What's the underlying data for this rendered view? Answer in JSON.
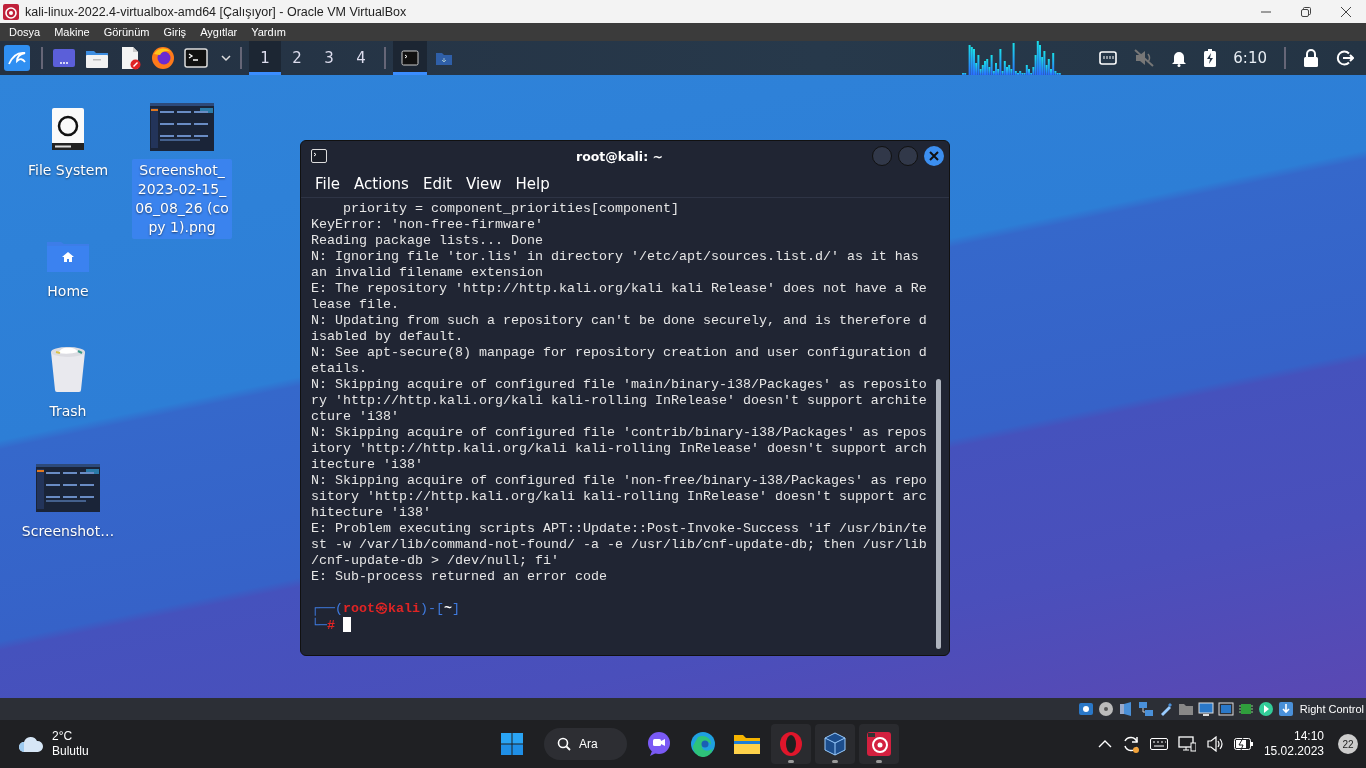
{
  "host_window": {
    "title": "kali-linux-2022.4-virtualbox-amd64 [Çalışıyor] - Oracle VM VirtualBox"
  },
  "vbox_menu": [
    "Dosya",
    "Makine",
    "Görünüm",
    "Giriş",
    "Aygıtlar",
    "Yardım"
  ],
  "kali_panel": {
    "launchers": [
      {
        "kind": "window"
      },
      {
        "kind": "files"
      },
      {
        "kind": "editor"
      },
      {
        "kind": "browser"
      },
      {
        "kind": "terminal"
      }
    ],
    "workspaces": [
      {
        "label": "1",
        "selected": true
      },
      {
        "label": "2",
        "selected": false
      },
      {
        "label": "3",
        "selected": false
      },
      {
        "label": "4",
        "selected": false
      }
    ],
    "tasks": [
      {
        "kind": "terminal",
        "selected": true
      },
      {
        "kind": "folder",
        "selected": false
      }
    ],
    "muted": true,
    "clock": "6:10"
  },
  "desktop_icons": [
    {
      "kind": "drive",
      "label": "File System",
      "selected": false
    },
    {
      "kind": "image",
      "label": "Screenshot_2023-02-15_06_08_26 (copy 1).png",
      "selected": true
    },
    {
      "kind": "home",
      "label": "Home",
      "selected": false
    },
    {
      "kind": "trash",
      "label": "Trash",
      "selected": false
    },
    {
      "kind": "image",
      "label": "Screenshot…",
      "selected": false
    }
  ],
  "terminal": {
    "title": "root@kali: ~",
    "menu": [
      "File",
      "Actions",
      "Edit",
      "View",
      "Help"
    ],
    "lines": [
      "    priority = component_priorities[component]",
      "KeyError: 'non-free-firmware'",
      "Reading package lists... Done",
      "N: Ignoring file 'tor.lis' in directory '/etc/apt/sources.list.d/' as it has",
      "an invalid filename extension",
      "E: The repository 'http://http.kali.org/kali kali Release' does not have a Re",
      "lease file.",
      "N: Updating from such a repository can't be done securely, and is therefore d",
      "isabled by default.",
      "N: See apt-secure(8) manpage for repository creation and user configuration d",
      "etails.",
      "N: Skipping acquire of configured file 'main/binary-i38/Packages' as reposito",
      "ry 'http://http.kali.org/kali kali-rolling InRelease' doesn't support archite",
      "cture 'i38'",
      "N: Skipping acquire of configured file 'contrib/binary-i38/Packages' as repos",
      "itory 'http://http.kali.org/kali kali-rolling InRelease' doesn't support arch",
      "itecture 'i38'",
      "N: Skipping acquire of configured file 'non-free/binary-i38/Packages' as repo",
      "sitory 'http://http.kali.org/kali kali-rolling InRelease' doesn't support arc",
      "hitecture 'i38'",
      "E: Problem executing scripts APT::Update::Post-Invoke-Success 'if /usr/bin/te",
      "st -w /var/lib/command-not-found/ -a -e /usr/lib/cnf-update-db; then /usr/lib",
      "/cnf-update-db > /dev/null; fi'",
      "E: Sub-process returned an error code"
    ],
    "prompt": [
      [
        {
          "kind": "frame",
          "text": "┌──("
        },
        {
          "kind": "user",
          "text": "root㉿kali"
        },
        {
          "kind": "frame",
          "text": ")-["
        },
        {
          "kind": "path",
          "text": "~"
        },
        {
          "kind": "frame",
          "text": "]"
        }
      ],
      [
        {
          "kind": "frame",
          "text": "└─"
        },
        {
          "kind": "user",
          "text": "#"
        }
      ]
    ]
  },
  "vbox_status": {
    "host_key": "Right Control"
  },
  "taskbar": {
    "weather": {
      "temp": "2°C",
      "condition": "Bulutlu"
    },
    "search_label": "Ara",
    "apps": [
      {
        "kind": "chat",
        "running": false
      },
      {
        "kind": "edge",
        "running": false
      },
      {
        "kind": "explorer",
        "running": false
      },
      {
        "kind": "opera",
        "running": true
      },
      {
        "kind": "vbox",
        "running": true
      },
      {
        "kind": "kali",
        "running": true
      }
    ],
    "time": "14:10",
    "date": "15.02.2023",
    "notifications": "22"
  }
}
